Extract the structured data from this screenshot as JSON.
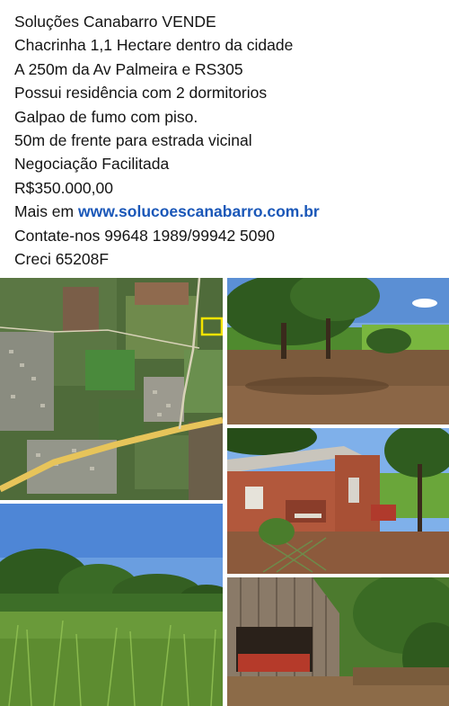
{
  "post": {
    "lines": [
      "Soluções Canabarro VENDE",
      "Chacrinha 1,1 Hectare dentro da cidade",
      "A 250m da Av Palmeira e RS305",
      "Possui residência com 2 dormitorios",
      "Galpao de fumo com piso.",
      "50m de frente para estrada vicinal",
      "Negociação Facilitada",
      "R$350.000,00"
    ],
    "website_prefix": "Mais em ",
    "website_link": "www.solucoescanabarro.com.br",
    "contact": "Contate-nos 99648 1989/99942 5090",
    "creci": "Creci 65208F"
  },
  "colors": {
    "text": "#141414",
    "link": "#1a57b8",
    "background": "#ffffff"
  },
  "gallery": {
    "photos": [
      {
        "id": "photo-map",
        "subject": "satellite-map-photo"
      },
      {
        "id": "photo-field",
        "subject": "property-field-photo"
      },
      {
        "id": "photo-house",
        "subject": "residence-photo"
      },
      {
        "id": "photo-corn",
        "subject": "cornfield-photo"
      },
      {
        "id": "photo-shed",
        "subject": "tobacco-shed-photo"
      }
    ]
  }
}
